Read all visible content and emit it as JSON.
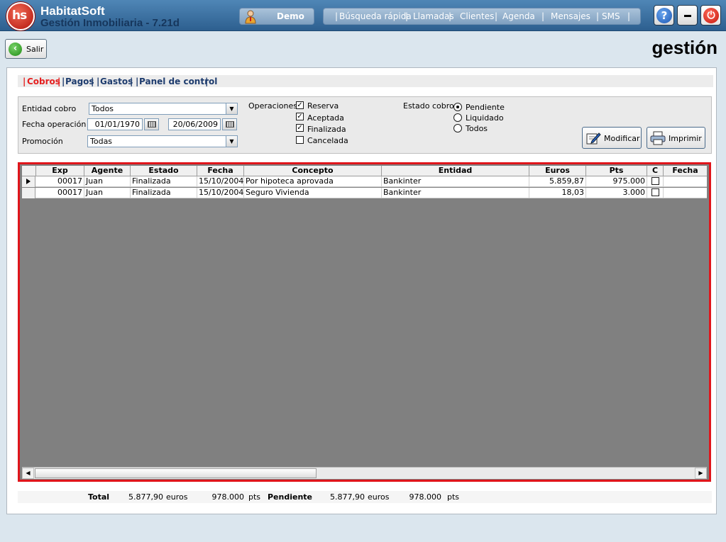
{
  "app": {
    "title": "HabitatSoft",
    "subtitle": "Gestión Inmobiliaria - 7.21d",
    "logo_text": "hs"
  },
  "header": {
    "user": "Demo",
    "nav": [
      "Búsqueda rápida",
      "Llamadas",
      "Clientes",
      "Agenda",
      "Mensajes",
      "SMS"
    ],
    "help_label": "?",
    "minimize_label": "–",
    "power_label": "⏻"
  },
  "toolbar": {
    "exit_label": "Salir",
    "page_heading": "gestión"
  },
  "tabs": [
    "Cobros",
    "Pagos",
    "Gastos",
    "Panel de control"
  ],
  "active_tab": "Cobros",
  "filters": {
    "entidad_label": "Entidad cobro",
    "entidad_value": "Todos",
    "fecha_label": "Fecha operación",
    "fecha_desde": "01/01/1970",
    "fecha_hasta": "20/06/2009",
    "promocion_label": "Promoción",
    "promocion_value": "Todas",
    "operaciones_label": "Operaciones",
    "operaciones": [
      {
        "label": "Reserva",
        "checked": true
      },
      {
        "label": "Aceptada",
        "checked": true
      },
      {
        "label": "Finalizada",
        "checked": true
      },
      {
        "label": "Cancelada",
        "checked": false
      }
    ],
    "estado_label": "Estado cobro",
    "estados": [
      {
        "label": "Pendiente",
        "selected": true
      },
      {
        "label": "Liquidado",
        "selected": false
      },
      {
        "label": "Todos",
        "selected": false
      }
    ],
    "modificar_label": "Modificar",
    "imprimir_label": "Imprimir"
  },
  "grid": {
    "columns": [
      "Exp",
      "Agente",
      "Estado",
      "Fecha",
      "Concepto",
      "Entidad",
      "Euros",
      "Pts",
      "C",
      "Fecha"
    ],
    "rows": [
      {
        "exp": "00017",
        "agente": "Juan",
        "estado": "Finalizada",
        "fecha": "15/10/2004",
        "concepto": "Por hipoteca aprovada",
        "entidad": "Bankinter",
        "euros": "5.859,87",
        "pts": "975.000",
        "c": false,
        "fecha2": ""
      },
      {
        "exp": "00017",
        "agente": "Juan",
        "estado": "Finalizada",
        "fecha": "15/10/2004",
        "concepto": "Seguro Vivienda",
        "entidad": "Bankinter",
        "euros": "18,03",
        "pts": "3.000",
        "c": false,
        "fecha2": ""
      }
    ]
  },
  "totals": {
    "total_label": "Total",
    "total_euros": "5.877,90",
    "euros_unit": "euros",
    "total_pts": "978.000",
    "pts_unit": "pts",
    "pendiente_label": "Pendiente",
    "pendiente_euros": "5.877,90",
    "pendiente_pts": "978.000"
  },
  "colors": {
    "header_bg": "#2d5f8f",
    "active_tab": "#e51f1f",
    "tab_text": "#1e3c6e",
    "grid_border": "#e0151b",
    "grid_empty": "#808080"
  }
}
